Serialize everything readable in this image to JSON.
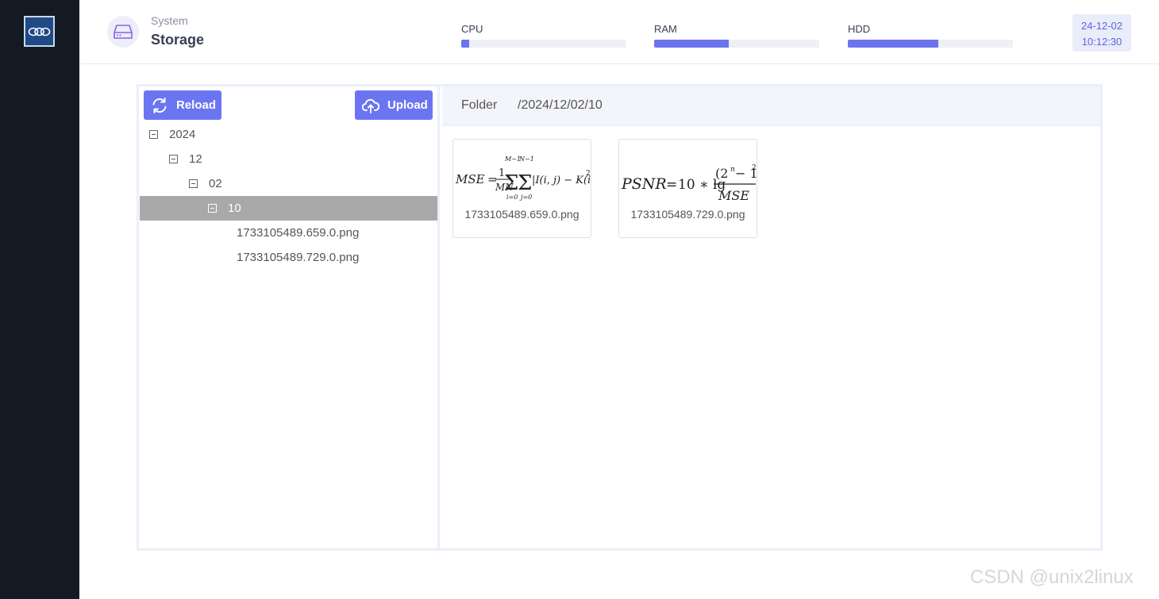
{
  "header": {
    "section": "System",
    "title": "Storage",
    "meters": [
      {
        "label": "CPU",
        "percent": 5
      },
      {
        "label": "RAM",
        "percent": 45
      },
      {
        "label": "HDD",
        "percent": 55
      }
    ],
    "date": "24-12-02",
    "time": "10:12:30",
    "accent": "#6b75f2"
  },
  "toolbar": {
    "reload_label": "Reload",
    "upload_label": "Upload"
  },
  "tree": {
    "nodes": [
      {
        "label": "2024"
      },
      {
        "label": "12"
      },
      {
        "label": "02"
      },
      {
        "label": "10"
      }
    ],
    "files": [
      "1733105489.659.0.png",
      "1733105489.729.0.png"
    ]
  },
  "folder": {
    "label": "Folder",
    "path": "/2024/12/02/10"
  },
  "files": [
    {
      "name": "1733105489.659.0.png"
    },
    {
      "name": "1733105489.729.0.png"
    }
  ],
  "watermark": "CSDN @unix2linux"
}
